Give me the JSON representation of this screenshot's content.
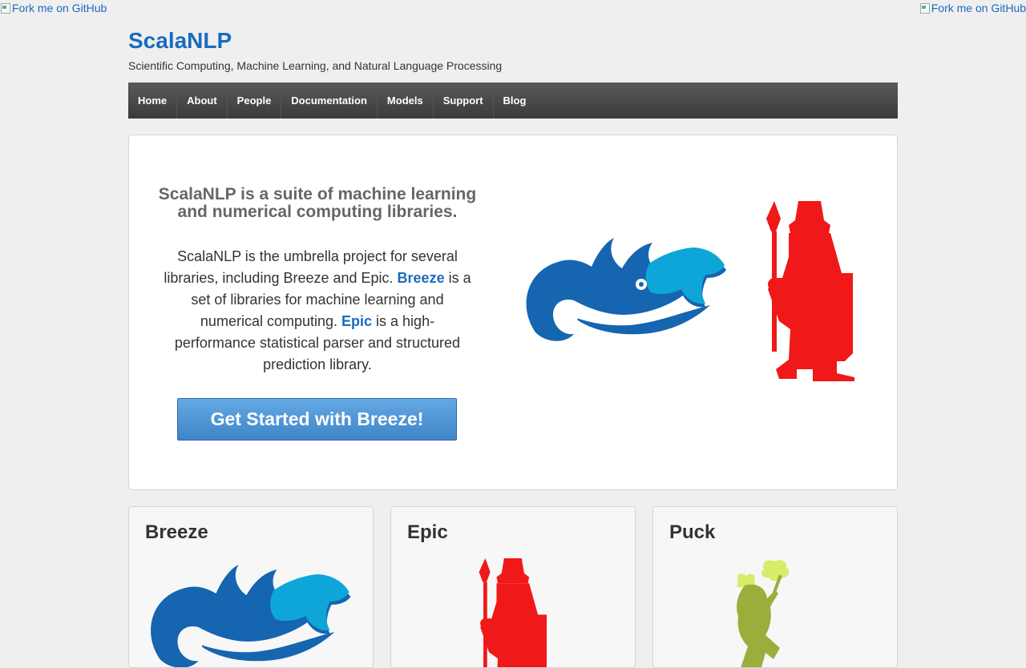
{
  "fork_links": {
    "left": "Fork me on GitHub",
    "right": "Fork me on GitHub"
  },
  "header": {
    "title": "ScalaNLP",
    "tagline": "Scientific Computing, Machine Learning, and Natural Language Processing"
  },
  "nav": {
    "items": [
      {
        "label": "Home"
      },
      {
        "label": "About"
      },
      {
        "label": "People"
      },
      {
        "label": "Documentation"
      },
      {
        "label": "Models"
      },
      {
        "label": "Support"
      },
      {
        "label": "Blog"
      }
    ]
  },
  "hero": {
    "title": "ScalaNLP is a suite of machine learning and numerical computing libraries.",
    "body": {
      "p1": "ScalaNLP is the umbrella project for several libraries, including Breeze and Epic. ",
      "link1": "Breeze",
      "p2": " is a set of libraries for machine learning and numerical computing. ",
      "link2": "Epic",
      "p3": " is a high-performance statistical parser and structured prediction library."
    },
    "cta_label": "Get Started with Breeze!"
  },
  "cards": [
    {
      "title": "Breeze",
      "logo": "breeze-logo"
    },
    {
      "title": "Epic",
      "logo": "epic-logo"
    },
    {
      "title": "Puck",
      "logo": "puck-logo"
    }
  ],
  "colors": {
    "link": "#1a6bbf",
    "breeze_dark": "#1565b0",
    "breeze_light": "#0ea6d8",
    "epic_red": "#f01818",
    "puck_green": "#9aae3c",
    "puck_light": "#d8ec6a"
  }
}
